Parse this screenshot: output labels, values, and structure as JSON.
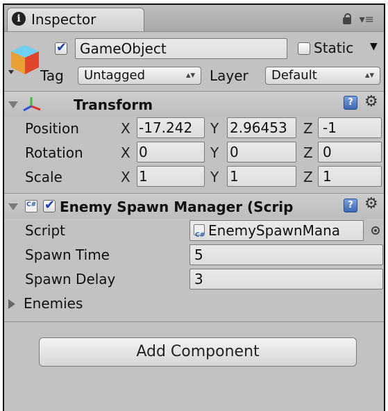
{
  "window": {
    "tab_title": "Inspector"
  },
  "object": {
    "name": "GameObject",
    "active": true,
    "static_label": "Static",
    "tag_label": "Tag",
    "tag_value": "Untagged",
    "layer_label": "Layer",
    "layer_value": "Default"
  },
  "transform": {
    "title": "Transform",
    "rows": [
      {
        "label": "Position",
        "x": "-17.242",
        "y": "2.96453",
        "z": "-1"
      },
      {
        "label": "Rotation",
        "x": "0",
        "y": "0",
        "z": "0"
      },
      {
        "label": "Scale",
        "x": "1",
        "y": "1",
        "z": "1"
      }
    ],
    "axis": {
      "x": "X",
      "y": "Y",
      "z": "Z"
    }
  },
  "spawn_manager": {
    "title": "Enemy Spawn Manager (Scrip",
    "enabled": true,
    "script_label": "Script",
    "script_value": "EnemySpawnMana",
    "spawn_time_label": "Spawn Time",
    "spawn_time_value": "5",
    "spawn_delay_label": "Spawn Delay",
    "spawn_delay_value": "3",
    "enemies_label": "Enemies"
  },
  "add_component_label": "Add Component",
  "icons": [
    "info-icon",
    "lock-icon",
    "menu-icon",
    "gameobject-cube-icon",
    "transform-axes-icon",
    "help-icon",
    "gear-icon",
    "script-icon",
    "object-picker-icon"
  ]
}
